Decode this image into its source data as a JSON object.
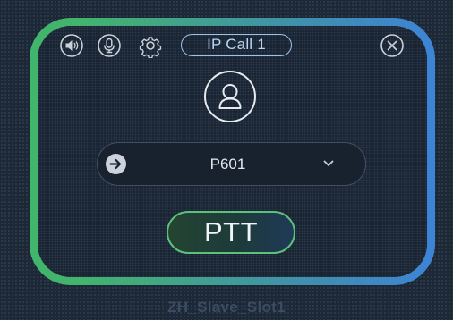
{
  "call": {
    "badge": "IP Call 1",
    "target": "P601",
    "ptt_label": "PTT"
  },
  "footer": {
    "slot": "ZH_Slave_Slot1"
  },
  "icons": {
    "speaker": "speaker-icon",
    "microphone": "microphone-icon",
    "settings": "gear-icon",
    "close": "close-icon",
    "avatar": "user-icon",
    "forward": "arrow-right-icon",
    "dropdown": "chevron-down-icon"
  },
  "colors": {
    "border_left": "#40b56b",
    "border_right": "#3d84d6",
    "badge_accent": "#9bc3ec",
    "ptt_border": "#5ec17b",
    "background": "#1d2836"
  }
}
